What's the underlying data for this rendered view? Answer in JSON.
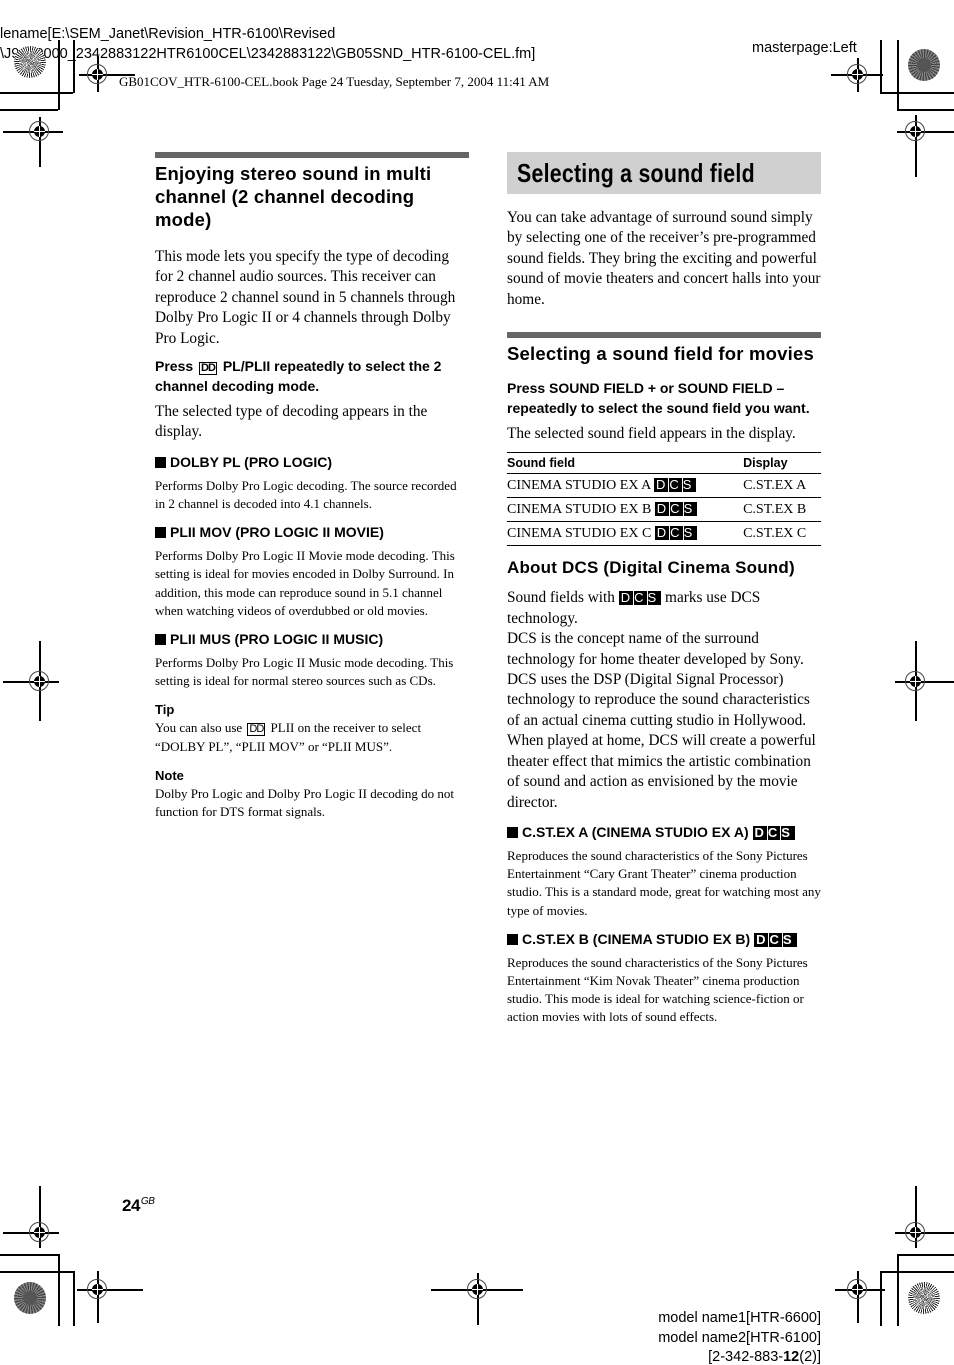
{
  "header": {
    "filename_line1": "lename[E:\\SEM_Janet\\Revision_HTR-6100\\Revised",
    "filename_line2": "\\J9040000_2342883122HTR6100CEL\\2342883122\\GB05SND_HTR-6100-CEL.fm]",
    "masterpage": "masterpage:Left",
    "book_info": "GB01COV_HTR-6100-CEL.book  Page 24  Tuesday, September 7, 2004  11:41 AM"
  },
  "left": {
    "heading": "Enjoying stereo sound in multi channel (2 channel decoding mode)",
    "intro": "This mode lets you specify the type of decoding for 2 channel audio sources. This receiver can reproduce 2 channel sound in 5 channels through Dolby Pro Logic II or 4 channels through Dolby Pro Logic.",
    "step_prefix": "Press ",
    "step_symbol": "DD",
    "step_suffix": " PL/PLII repeatedly to select the 2 channel decoding mode.",
    "step_result": "The selected type of decoding appears in the display.",
    "modes": [
      {
        "title": "DOLBY PL (PRO LOGIC)",
        "desc": "Performs Dolby Pro Logic decoding. The source recorded in 2 channel is decoded into 4.1 channels."
      },
      {
        "title": "PLII MOV (PRO LOGIC II MOVIE)",
        "desc": "Performs Dolby Pro Logic II Movie mode decoding. This setting is ideal for movies encoded in Dolby Surround. In addition, this mode can reproduce sound in 5.1 channel when watching videos of overdubbed or old movies."
      },
      {
        "title": "PLII MUS (PRO LOGIC II MUSIC)",
        "desc": "Performs Dolby Pro Logic II Music mode decoding. This setting is ideal for normal stereo sources such as CDs."
      }
    ],
    "tip_label": "Tip",
    "tip_prefix": "You can also use ",
    "tip_symbol": "DD",
    "tip_suffix": " PLII on the receiver to select “DOLBY PL”, “PLII MOV” or “PLII MUS”.",
    "note_label": "Note",
    "note_text": "Dolby Pro Logic and Dolby Pro Logic II decoding do not function for DTS format signals."
  },
  "right": {
    "title": "Selecting a sound field",
    "intro": "You can take advantage of surround sound simply by selecting one of the receiver’s pre-programmed sound fields. They bring the exciting and powerful sound of movie theaters and concert halls into your home.",
    "heading": "Selecting a sound field for movies",
    "step": "Press SOUND FIELD + or SOUND FIELD – repeatedly to select the sound field you want.",
    "step_result": "The selected sound field appears in the display.",
    "table": {
      "headers": [
        "Sound field",
        "Display"
      ],
      "rows": [
        {
          "field": "CINEMA STUDIO EX A",
          "display": "C.ST.EX A"
        },
        {
          "field": "CINEMA STUDIO EX B",
          "display": "C.ST.EX B"
        },
        {
          "field": "CINEMA STUDIO EX C",
          "display": "C.ST.EX C"
        }
      ]
    },
    "dcs_letters": [
      "D",
      "C",
      "S"
    ],
    "about_heading": "About DCS (Digital Cinema Sound)",
    "about_p1_prefix": "Sound fields with ",
    "about_p1_suffix": " marks use DCS technology.",
    "about_p2": "DCS is the concept name of the surround technology for home theater developed by Sony.",
    "about_p3": "DCS uses the DSP (Digital Signal Processor) technology to reproduce the sound characteristics of an actual cinema cutting studio in Hollywood.",
    "about_p4": "When played at home, DCS will create a powerful theater effect that mimics the artistic combination of sound and action as envisioned by the movie director.",
    "modes": [
      {
        "title": "C.ST.EX A (CINEMA STUDIO EX A)",
        "desc": "Reproduces the sound characteristics of the Sony Pictures Entertainment “Cary Grant Theater” cinema production studio. This is a standard mode, great for watching most any type of movies."
      },
      {
        "title": "C.ST.EX B (CINEMA STUDIO EX B)",
        "desc": "Reproduces the sound characteristics of the Sony Pictures Entertainment “Kim Novak Theater” cinema production studio. This mode is ideal for watching science-fiction or action movies with lots of sound effects."
      }
    ]
  },
  "footer": {
    "page_number": "24",
    "page_suffix": "GB",
    "model1": "model name1[HTR-6600]",
    "model2": "model name2[HTR-6100]",
    "code_prefix": "[2-342-883-",
    "code_bold": "12",
    "code_suffix": "(2)]"
  }
}
